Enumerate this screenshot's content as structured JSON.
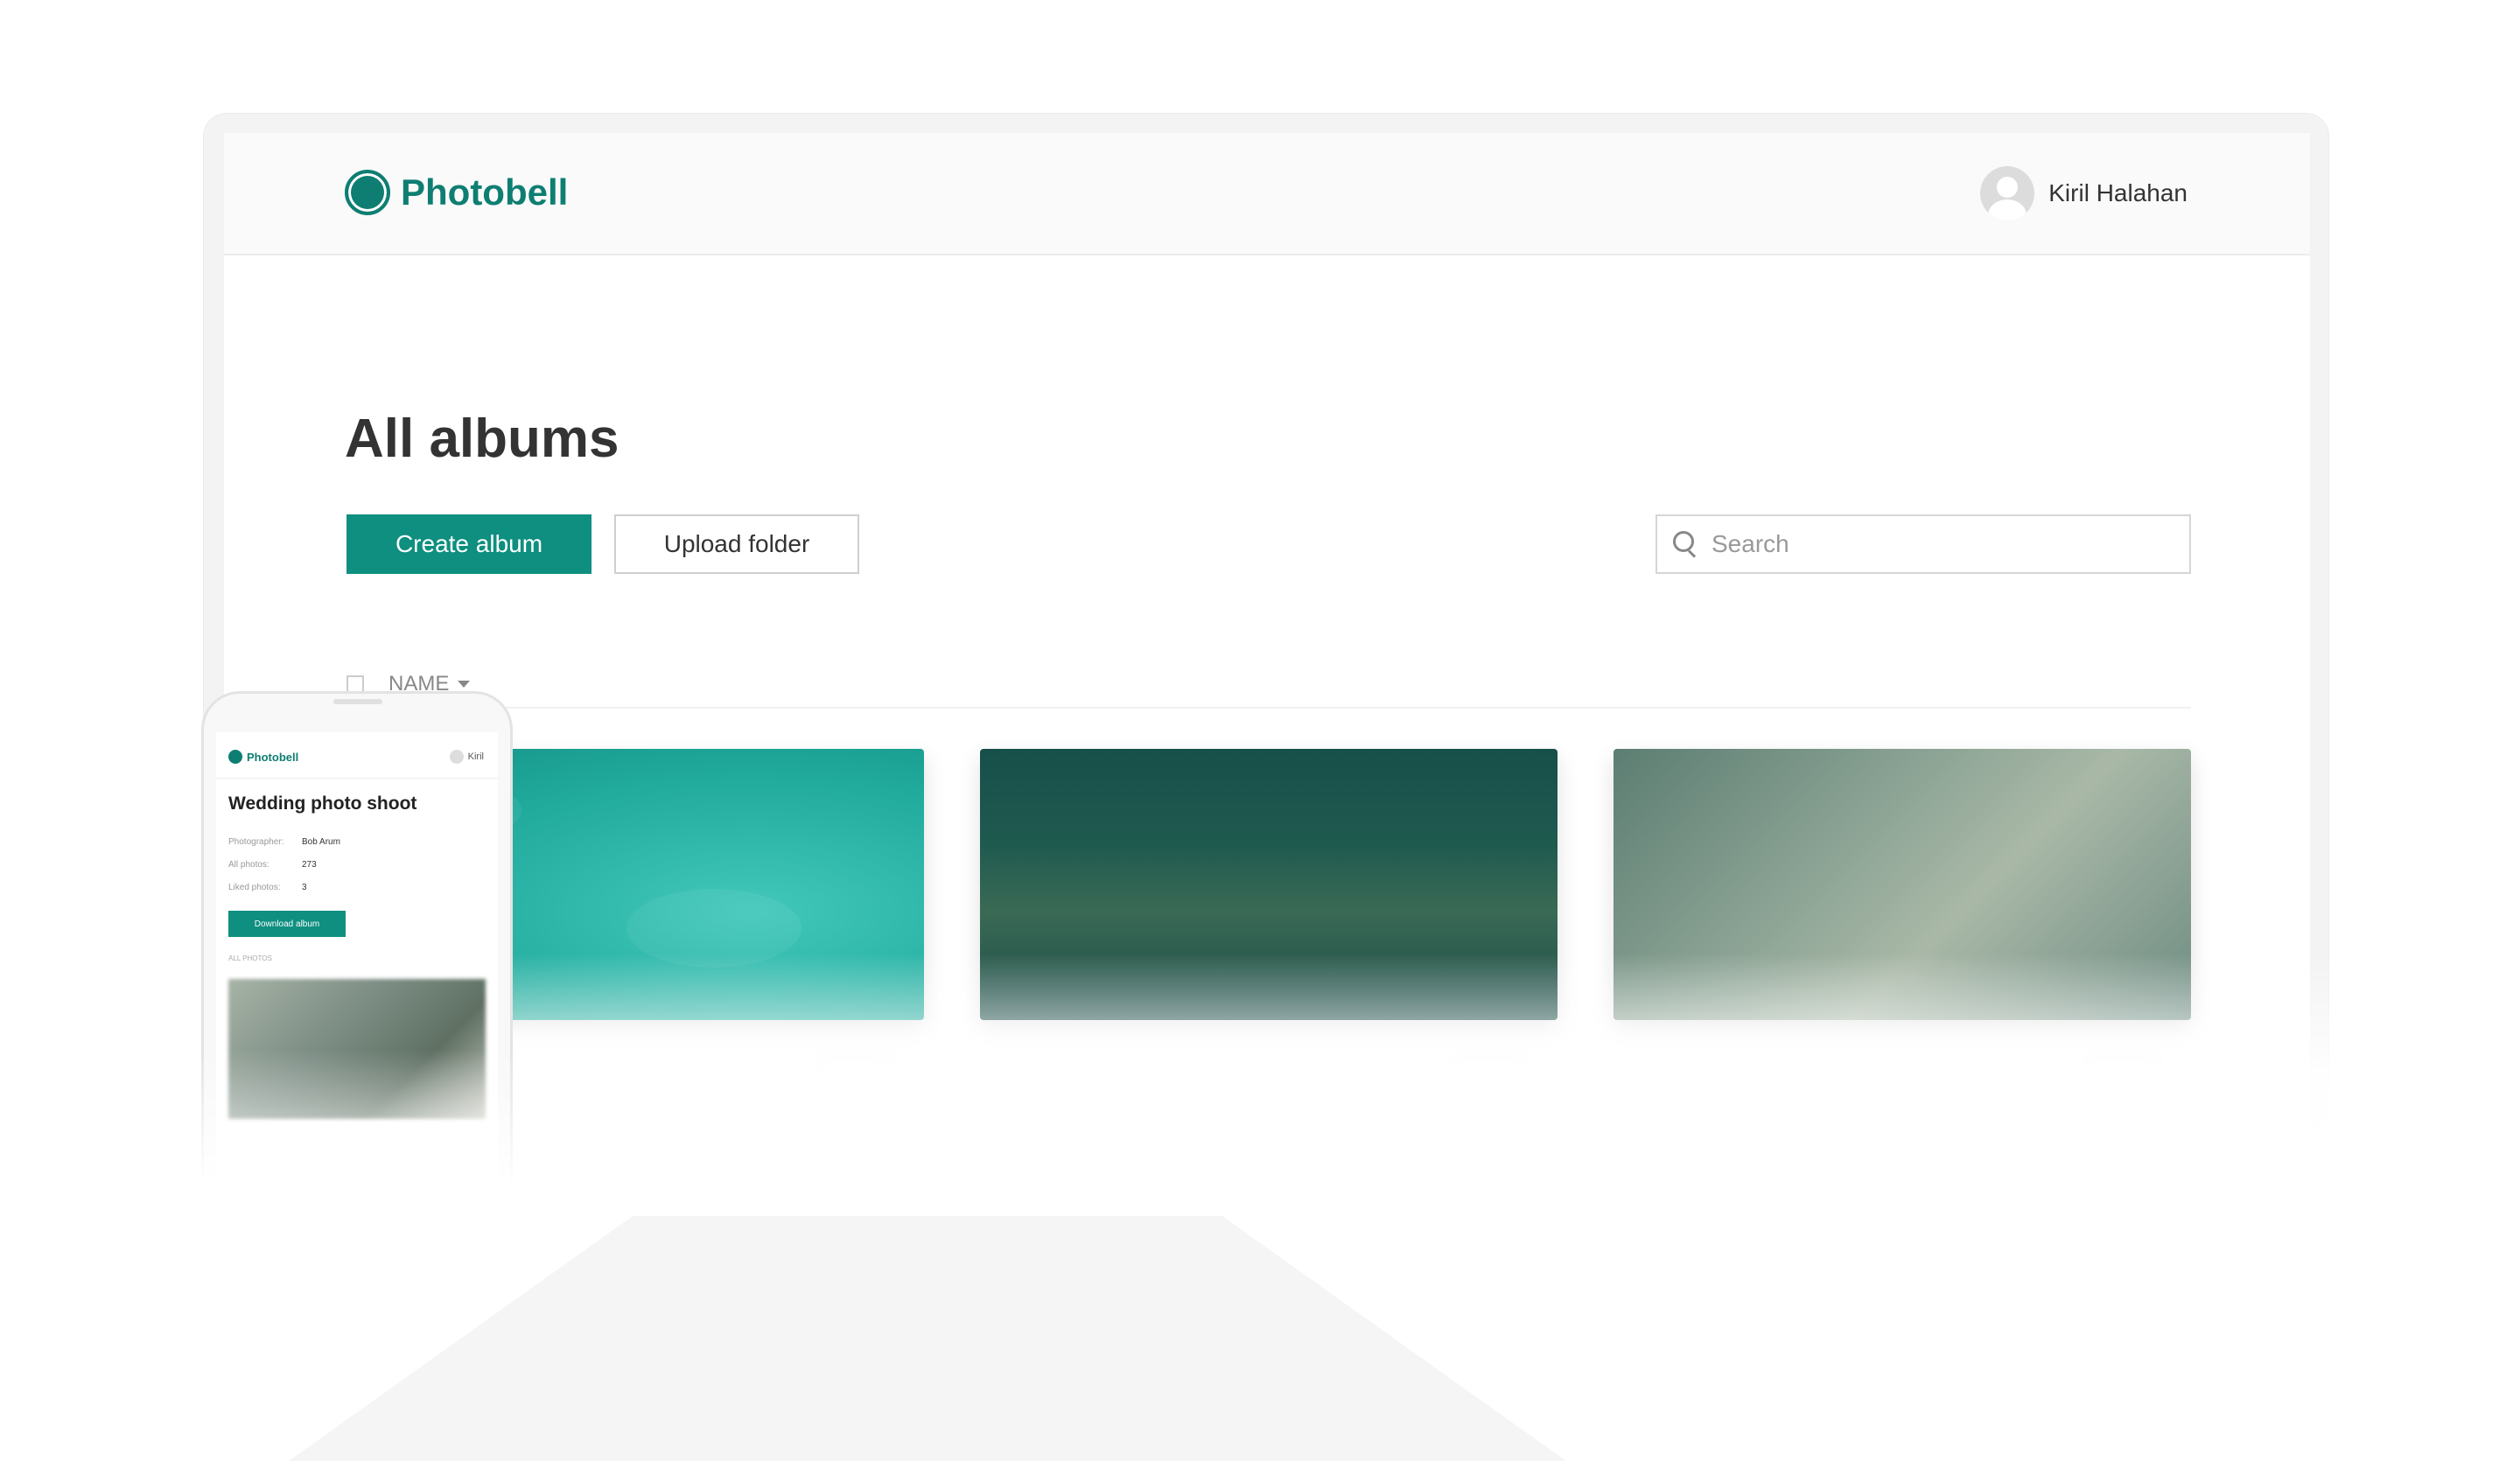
{
  "app": {
    "name": "Photobell",
    "user_name": "Kiril Halahan"
  },
  "main": {
    "title": "All albums",
    "create_label": "Create album",
    "upload_label": "Upload folder",
    "search_placeholder": "Search",
    "column_name": "NAME"
  },
  "albums": [
    {
      "cover": "aerial-sea-villas",
      "title": "",
      "count": ""
    },
    {
      "cover": "feet-over-cliff",
      "title": "",
      "count": ""
    },
    {
      "cover": "map-and-camera",
      "title": "",
      "count": ""
    }
  ],
  "phone": {
    "brand": "Photobell",
    "user": "Kiril",
    "album_title": "Wedding photo shoot",
    "rows": [
      {
        "key": "Photographer:",
        "value": "Bob Arum"
      },
      {
        "key": "All photos:",
        "value": "273"
      },
      {
        "key": "Liked photos:",
        "value": "3"
      }
    ],
    "download_label": "Download album",
    "section_label": "ALL PHOTOS"
  },
  "colors": {
    "brand": "#0e7e72",
    "primary_button": "#0e8f80"
  },
  "icons": [
    "logo-icon",
    "user-avatar-icon",
    "search-icon",
    "sort-caret-icon"
  ]
}
